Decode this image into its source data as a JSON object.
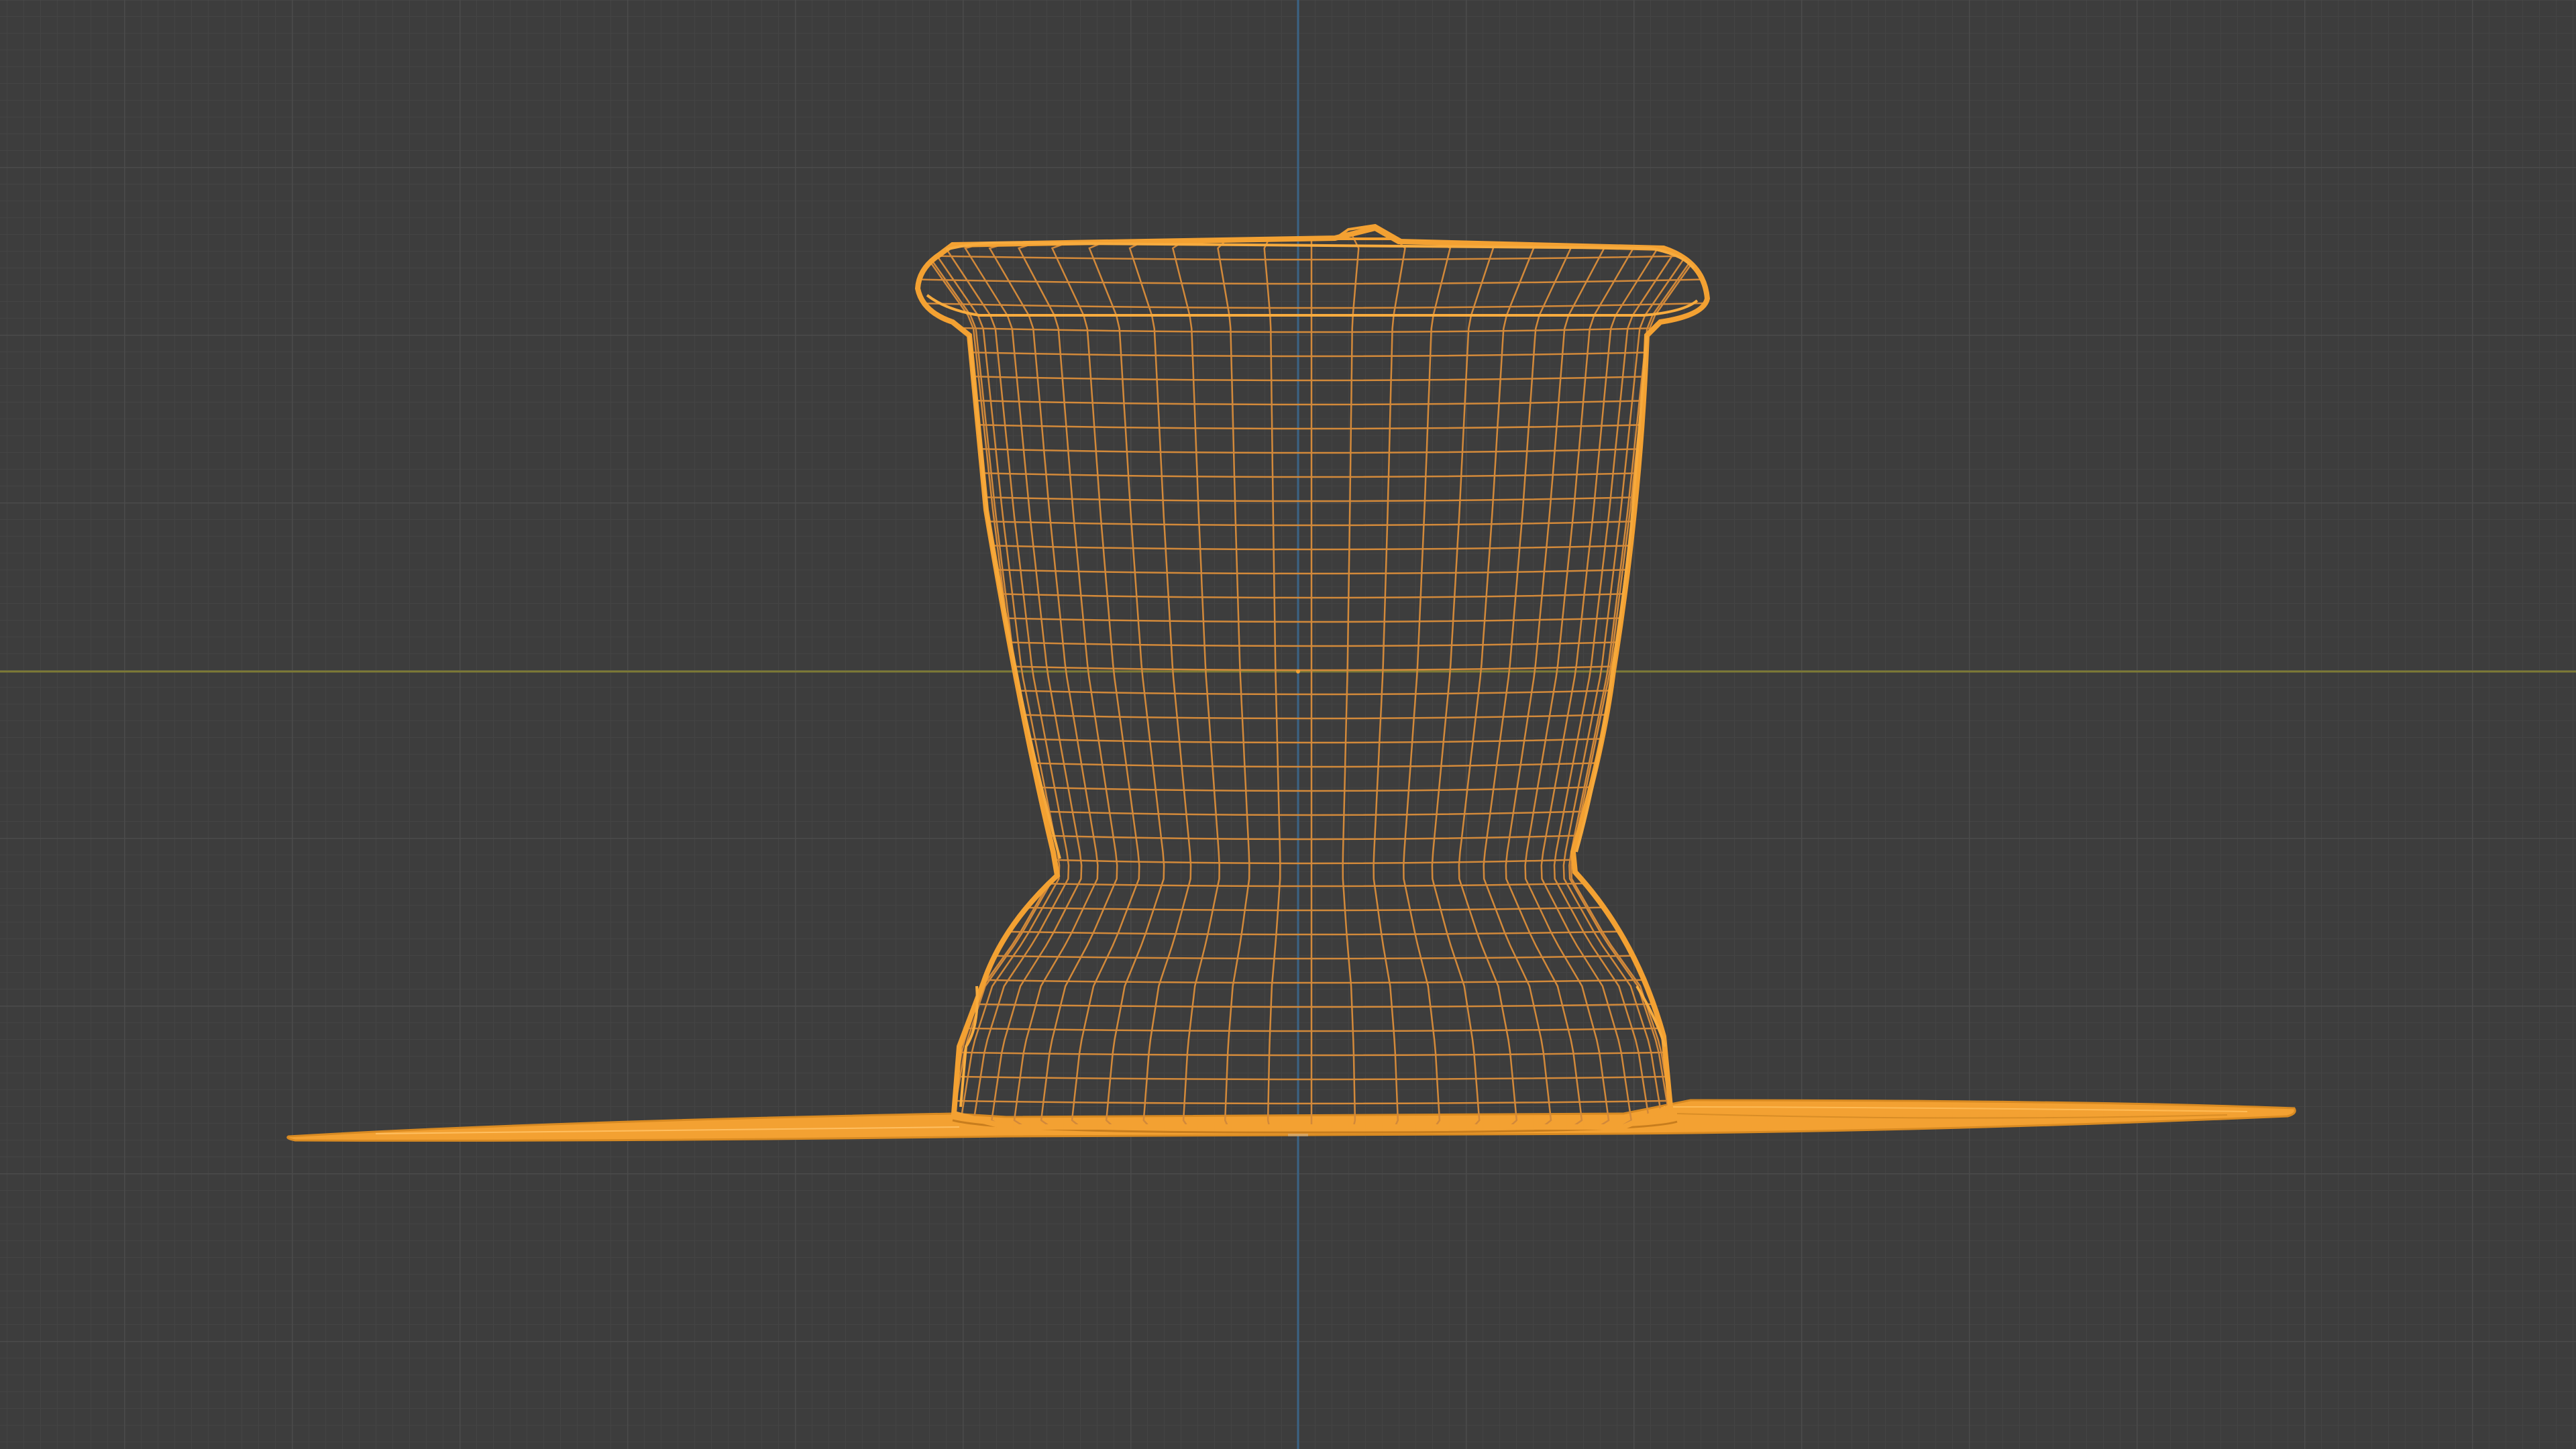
{
  "viewport": {
    "background_color": "#3d3d3d",
    "grid_minor_color": "#464646",
    "grid_major_color": "#4e4e4e",
    "x_axis_color": "#7f7f34",
    "z_axis_color": "#3f6a8a",
    "wireframe_color": "#f4a030",
    "wireframe_edge_color": "#e0952c",
    "mode": "wireframe",
    "view": "front-orthographic"
  },
  "object": {
    "icon": "mesh-icon",
    "selected": true
  }
}
